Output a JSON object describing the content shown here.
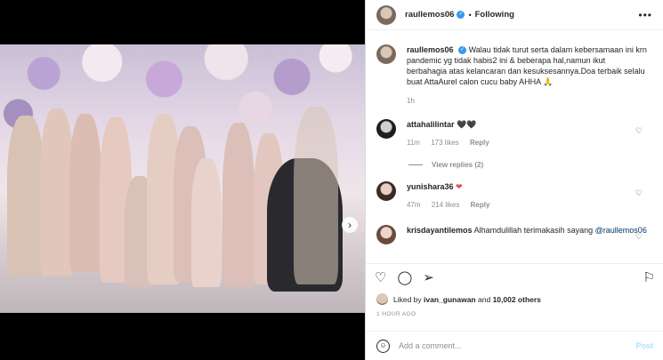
{
  "post": {
    "username": "raullemos06",
    "following_label": "Following",
    "more_label": "•••"
  },
  "caption": {
    "username": "raullemos06",
    "text": "Walau tidak turut serta dalam kebersamaan ini krn pandemic yg tidak habis2 ini & beberapa hal,namun ikut berbahagia atas kelancaran dan kesuksesannya.Doa terbaik selalu buat AttaAurel calon cucu baby AHHA 🙏",
    "time": "1h"
  },
  "comments": [
    {
      "username": "attahalilintar",
      "text": "🖤🖤",
      "time": "11m",
      "likes": "173 likes",
      "reply": "Reply",
      "view_replies": "View replies (2)"
    },
    {
      "username": "yunishara36",
      "text": "❤",
      "time": "47m",
      "likes": "214 likes",
      "reply": "Reply"
    },
    {
      "username": "krisdayantilemos",
      "text": "Alhamdulillah terimakasih sayang",
      "mention": "@raullemos06"
    }
  ],
  "likes": {
    "prefix": "Liked by ",
    "user": "ivan_gunawan",
    "middle": " and ",
    "count": "10,002 others"
  },
  "timestamp": "1 HOUR AGO",
  "composer": {
    "placeholder": "Add a comment...",
    "post_label": "Post"
  },
  "carousel": {
    "slide_count": 10,
    "active_index": 0
  }
}
